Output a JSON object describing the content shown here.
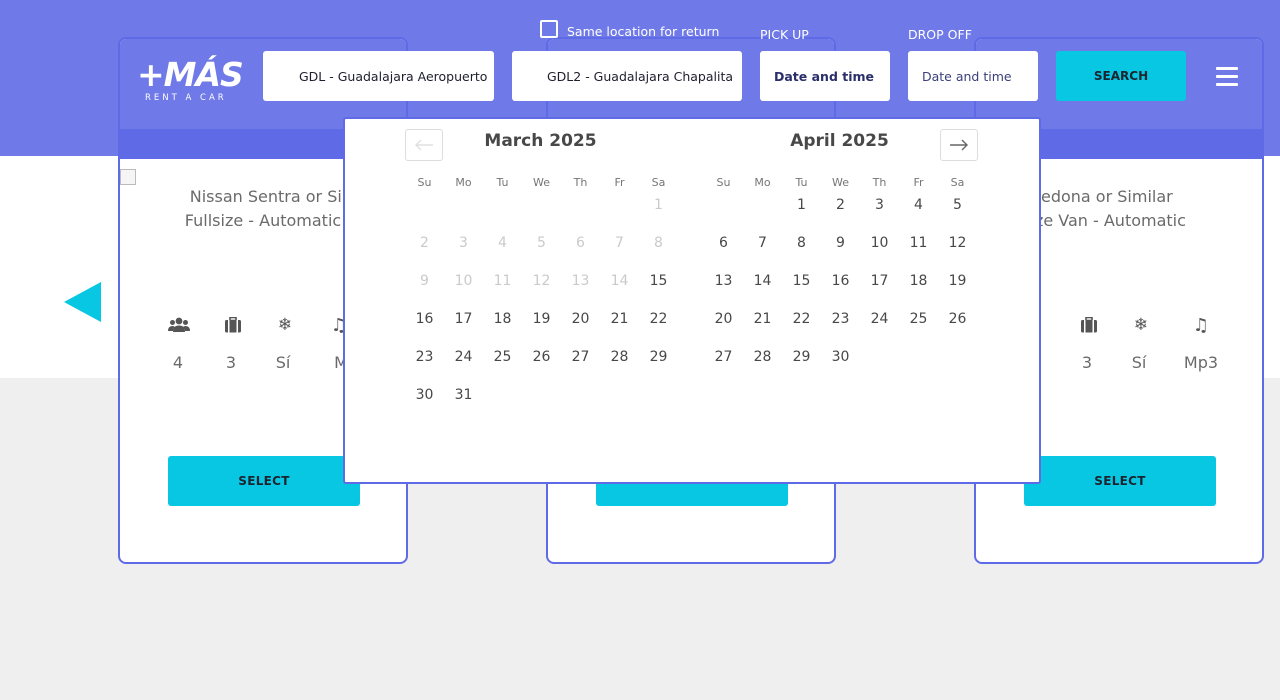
{
  "header": {
    "logo_main": "+MÁS",
    "logo_sub": "RENT A CAR",
    "same_location_label": "Same location for return",
    "pickup_location": "GDL - Guadalajara Aeropuerto",
    "dropoff_location": "GDL2 - Guadalajara  Chapalita",
    "pickup_label": "PICK UP",
    "dropoff_label": "DROP OFF",
    "pickup_date_placeholder": "Date and time",
    "dropoff_date_placeholder": "Date and time",
    "search_label": "SEARCH"
  },
  "cars": [
    {
      "name": "Nissan Sentra or Simil",
      "category": "Fullsize - Automatic",
      "people": "4",
      "bags": "3",
      "ac": "Sí",
      "audio": "M",
      "select_label": "SELECT"
    },
    {
      "select_label": ""
    },
    {
      "name": "Kia Sedona or Similar",
      "category": "dsize Van - Automatic",
      "people": "",
      "bags": "3",
      "ac": "Sí",
      "audio": "Mp3",
      "select_label": "SELECT"
    }
  ],
  "calendar": {
    "months": [
      {
        "title": "March 2025",
        "weekdays": [
          "Su",
          "Mo",
          "Tu",
          "We",
          "Th",
          "Fr",
          "Sa"
        ],
        "first_weekday": 6,
        "days": 31,
        "disabled_through": 14
      },
      {
        "title": "April 2025",
        "weekdays": [
          "Su",
          "Mo",
          "Tu",
          "We",
          "Th",
          "Fr",
          "Sa"
        ],
        "first_weekday": 2,
        "days": 30,
        "disabled_through": 0
      }
    ]
  },
  "colors": {
    "brand": "#6f79e8",
    "border": "#5f6be6",
    "accent": "#07c7e2"
  },
  "icons": {
    "prev": "arrow-left-icon",
    "next": "arrow-right-icon",
    "menu": "hamburger-menu-icon",
    "carousel_prev": "triangle-left-icon"
  }
}
